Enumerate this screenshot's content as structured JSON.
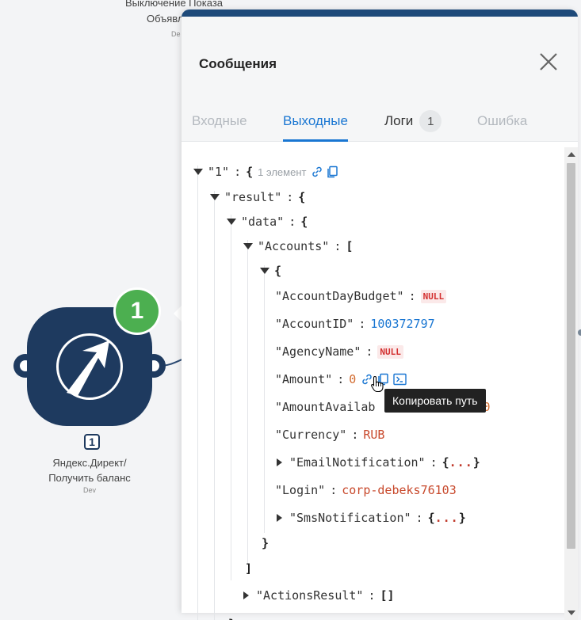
{
  "canvas": {
    "top_node_label_line1": "Выключение Показа",
    "top_node_label_line2": "Объявл",
    "top_node_dev": "De",
    "node_badge": "1",
    "node_index": "1",
    "node_label_line1": "Яндекс.Директ/",
    "node_label_line2": "Получить баланс",
    "node_dev": "Dev",
    "brand_color": "#1e3a5f",
    "badge_color": "#4caf50"
  },
  "panel": {
    "title": "Сообщения",
    "close_icon": "close-icon",
    "tabs": [
      {
        "label": "Входные",
        "state": "inactive"
      },
      {
        "label": "Выходные",
        "state": "active"
      },
      {
        "label": "Логи",
        "state": "normal",
        "count": "1"
      },
      {
        "label": "Ошибка",
        "state": "inactive"
      }
    ]
  },
  "tree": {
    "root_key": "\"1\"",
    "root_meta": "1 элемент",
    "result_key": "\"result\"",
    "data_key": "\"data\"",
    "accounts_key": "\"Accounts\"",
    "fields": {
      "account_day_budget": {
        "key": "\"AccountDayBudget\"",
        "value": "NULL"
      },
      "account_id": {
        "key": "\"AccountID\"",
        "value": "100372797"
      },
      "agency_name": {
        "key": "\"AgencyName\"",
        "value": "NULL"
      },
      "amount": {
        "key": "\"Amount\"",
        "value": "0"
      },
      "amount_available": {
        "key": "\"AmountAvailab",
        "value": "0"
      },
      "currency": {
        "key": "\"Currency\"",
        "value": "RUB"
      },
      "email_notification": {
        "key": "\"EmailNotification\"",
        "value": "..."
      },
      "login": {
        "key": "\"Login\"",
        "value": "corp-debeks76103"
      },
      "sms_notification": {
        "key": "\"SmsNotification\"",
        "value": "..."
      }
    },
    "actions_result_key": "\"ActionsResult\"",
    "actions_result_value": "[]",
    "colon": ":",
    "open_brace": "{",
    "close_brace": "}",
    "open_bracket": "[",
    "close_bracket": "]"
  },
  "tooltip": "Копировать путь"
}
